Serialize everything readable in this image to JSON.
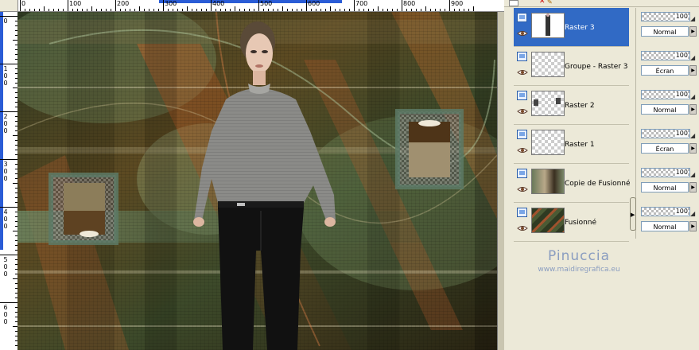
{
  "ruler": {
    "top_labels": [
      "0",
      "100",
      "200",
      "300",
      "400",
      "500",
      "600",
      "700",
      "800",
      "900"
    ],
    "left_labels": [
      "0",
      "100",
      "200",
      "300",
      "400",
      "500",
      "600"
    ]
  },
  "layers": [
    {
      "name": "Raster 3",
      "opacity": "100",
      "blend": "Normal",
      "selected": true
    },
    {
      "name": "Groupe - Raster 3",
      "opacity": "100",
      "blend": "Écran",
      "selected": false
    },
    {
      "name": "Raster 2",
      "opacity": "100",
      "blend": "Normal",
      "selected": false
    },
    {
      "name": "Raster 1",
      "opacity": "100",
      "blend": "Écran",
      "selected": false
    },
    {
      "name": "Copie de Fusionné",
      "opacity": "100",
      "blend": "Normal",
      "selected": false
    },
    {
      "name": "Fusionné",
      "opacity": "100",
      "blend": "Normal",
      "selected": false
    }
  ],
  "watermark": {
    "name": "Pinuccia",
    "url": "www.maidiregrafica.eu"
  },
  "colors": {
    "selection": "#316ac5",
    "panel_bg": "#ece9d8",
    "watermark": "#8a9dc0"
  },
  "icons": {
    "layer_type": "raster-layer-icon",
    "visibility": "eye-icon"
  }
}
